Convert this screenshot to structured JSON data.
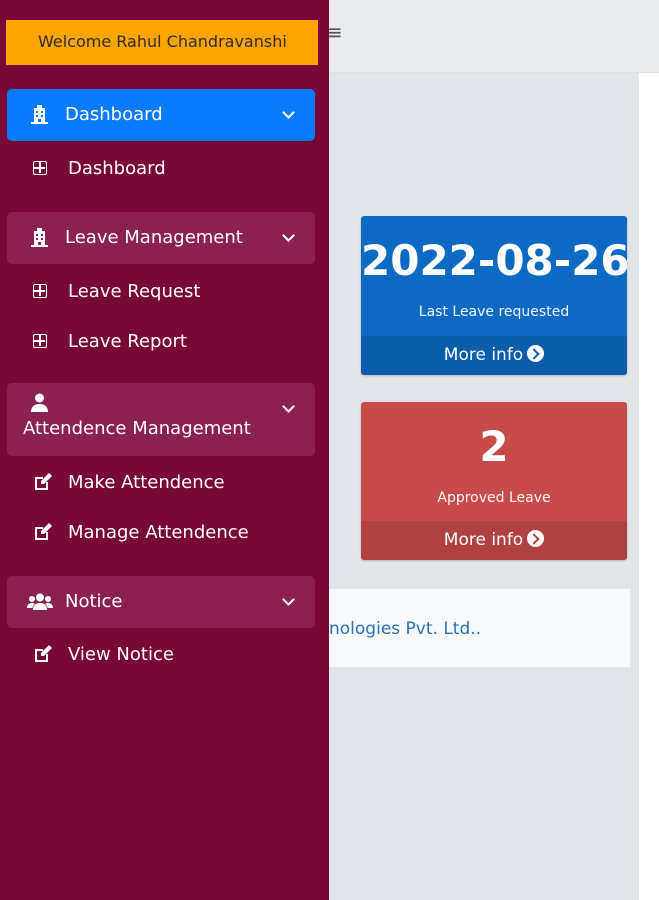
{
  "header": {
    "welcome_text": "Welcome Rahul Chandravanshi",
    "menu_icon": "hamburger-icon"
  },
  "sidebar": {
    "groups": [
      {
        "label": "Dashboard",
        "icon": "building-icon",
        "active": true,
        "items": [
          {
            "label": "Dashboard",
            "icon": "plus-square-icon"
          }
        ]
      },
      {
        "label": "Leave Management",
        "icon": "building-icon",
        "active": false,
        "items": [
          {
            "label": "Leave Request",
            "icon": "plus-square-icon"
          },
          {
            "label": "Leave Report",
            "icon": "plus-square-icon"
          }
        ]
      },
      {
        "label": "Attendence Management",
        "icon": "user-icon",
        "active": false,
        "items": [
          {
            "label": "Make Attendence",
            "icon": "edit-icon"
          },
          {
            "label": "Manage Attendence",
            "icon": "edit-icon"
          }
        ]
      },
      {
        "label": "Notice",
        "icon": "users-icon",
        "active": false,
        "items": [
          {
            "label": "View Notice",
            "icon": "edit-icon"
          }
        ]
      }
    ]
  },
  "stats": [
    {
      "value": "2022-08-26",
      "caption": "Last Leave requested",
      "link": "More info",
      "color": "#0d6ac4"
    },
    {
      "value": "2",
      "caption": "Approved Leave",
      "link": "More info",
      "color": "#c94b49"
    }
  ],
  "footer": {
    "text": "nologies Pvt. Ltd.."
  },
  "colors": {
    "sidebar_bg": "#790836",
    "active": "#0b7bfd",
    "welcome_bg": "#ffa400"
  }
}
